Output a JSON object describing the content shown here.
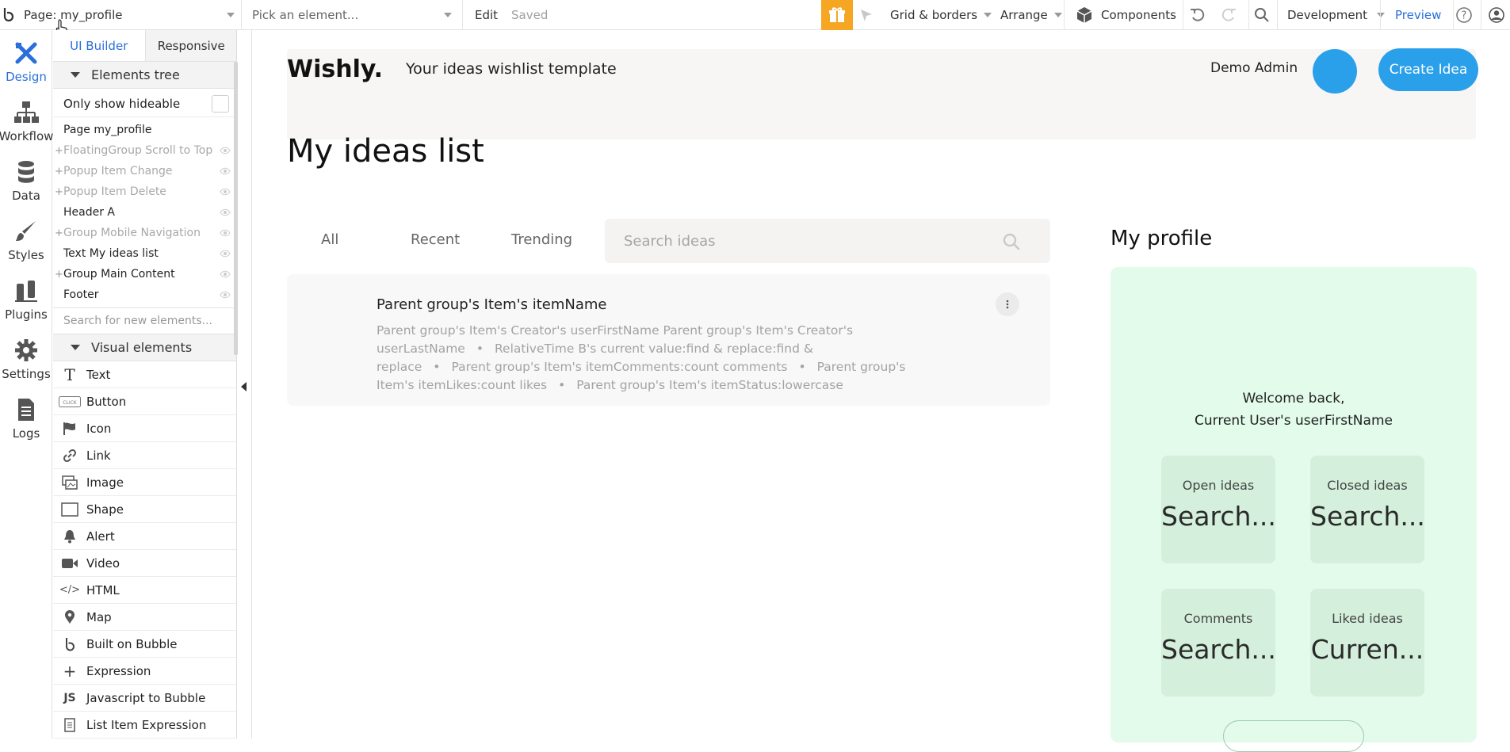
{
  "topbar": {
    "page_label": "Page: my_profile",
    "element_picker": "Pick an element...",
    "edit_label": "Edit",
    "save_status": "Saved",
    "grid_label": "Grid & borders",
    "arrange_label": "Arrange",
    "components_label": "Components",
    "env_label": "Development",
    "preview_label": "Preview"
  },
  "rail": {
    "items": [
      {
        "label": "Design",
        "icon": "design-icon"
      },
      {
        "label": "Workflow",
        "icon": "workflow-icon"
      },
      {
        "label": "Data",
        "icon": "data-icon"
      },
      {
        "label": "Styles",
        "icon": "styles-icon"
      },
      {
        "label": "Plugins",
        "icon": "plugins-icon"
      },
      {
        "label": "Settings",
        "icon": "settings-icon"
      },
      {
        "label": "Logs",
        "icon": "logs-icon"
      }
    ]
  },
  "panel": {
    "tab_ui_builder": "UI Builder",
    "tab_responsive": "Responsive",
    "elements_tree_label": "Elements tree",
    "only_hideable_label": "Only show hideable",
    "tree": [
      {
        "label": "Page my_profile"
      },
      {
        "label": "FloatingGroup Scroll to Top"
      },
      {
        "label": "Popup Item Change"
      },
      {
        "label": "Popup Item Delete"
      },
      {
        "label": "Header A"
      },
      {
        "label": "Group Mobile Navigation"
      },
      {
        "label": "Text My ideas list"
      },
      {
        "label": "Group Main Content"
      },
      {
        "label": "Footer"
      }
    ],
    "search_new_placeholder": "Search for new elements...",
    "visual_elements_label": "Visual elements",
    "visual": [
      {
        "label": "Text",
        "icon": "T"
      },
      {
        "label": "Button",
        "icon": "CLICK"
      },
      {
        "label": "Icon",
        "icon": "flag-icon"
      },
      {
        "label": "Link",
        "icon": "link-icon"
      },
      {
        "label": "Image",
        "icon": "image-icon"
      },
      {
        "label": "Shape",
        "icon": "shape-icon"
      },
      {
        "label": "Alert",
        "icon": "bell-icon"
      },
      {
        "label": "Video",
        "icon": "video-icon"
      },
      {
        "label": "HTML",
        "icon": "</>"
      },
      {
        "label": "Map",
        "icon": "map-pin-icon"
      },
      {
        "label": "Built on Bubble",
        "icon": "b"
      },
      {
        "label": "Expression",
        "icon": "+"
      },
      {
        "label": "Javascript to Bubble",
        "icon": "JS"
      },
      {
        "label": "List Item Expression",
        "icon": "list-icon"
      }
    ]
  },
  "canvas": {
    "logo": "Wishly.",
    "tagline": "Your ideas wishlist template",
    "user_name": "Demo Admin",
    "create_button": "Create Idea",
    "page_title": "My ideas list",
    "filters": [
      "All",
      "Recent",
      "Trending"
    ],
    "search_placeholder": "Search ideas",
    "idea": {
      "name": "Parent group's Item's itemName",
      "meta_1": "Parent group's Item's Creator's userFirstName Parent group's Item's Creator's userLastName",
      "meta_2": "RelativeTime B's current value:find & replace:find & replace",
      "meta_3": "Parent group's Item's itemComments:count comments",
      "meta_4": "Parent group's Item's itemLikes:count likes",
      "meta_5": "Parent group's Item's itemStatus:lowercase"
    },
    "profile_title": "My profile",
    "welcome_line1": "Welcome back,",
    "welcome_line2": "Current User's userFirstName",
    "stats": [
      {
        "label": "Open ideas",
        "value": "Search..."
      },
      {
        "label": "Closed ideas",
        "value": "Search..."
      },
      {
        "label": "Comments",
        "value": "Search..."
      },
      {
        "label": "Liked ideas",
        "value": "Curren..."
      }
    ]
  },
  "colors": {
    "accent": "#2ba0ea",
    "brand_blue": "#2a6fdb",
    "gift": "#f5a623",
    "profile_bg": "#e2fbea"
  }
}
